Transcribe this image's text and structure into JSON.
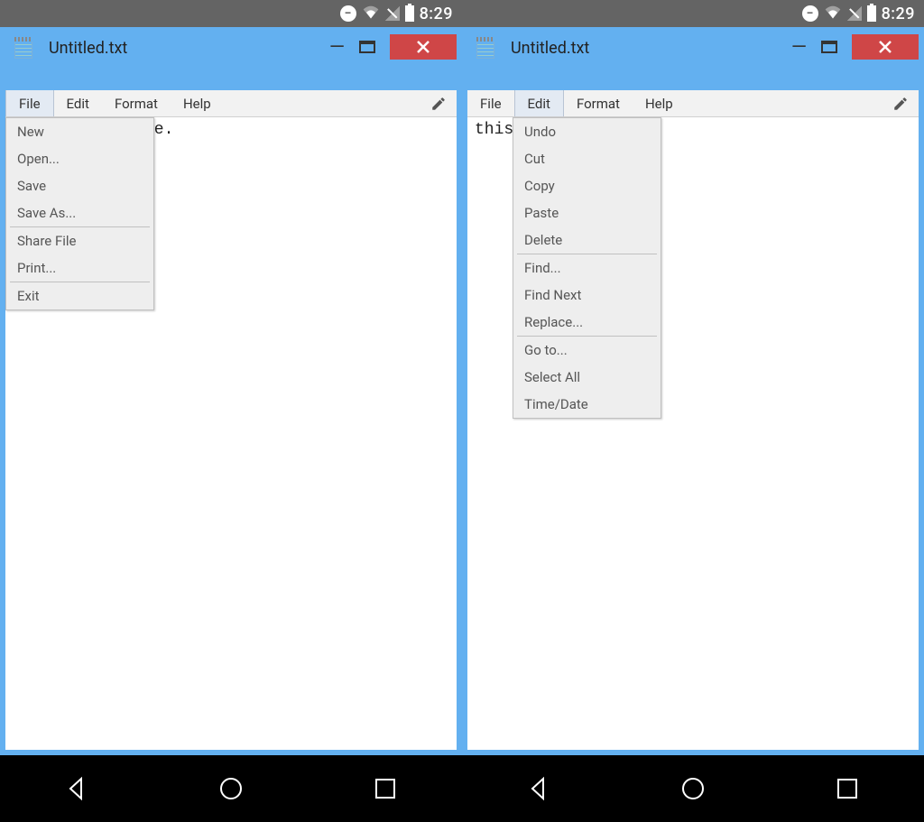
{
  "status_bar": {
    "time": "8:29"
  },
  "window": {
    "title": "Untitled.txt"
  },
  "menubar": {
    "file": "File",
    "edit": "Edit",
    "format": "Format",
    "help": "Help"
  },
  "file_menu": {
    "new": "New",
    "open": "Open...",
    "save": "Save",
    "save_as": "Save As...",
    "share_file": "Share File",
    "print": "Print...",
    "exit": "Exit"
  },
  "edit_menu": {
    "undo": "Undo",
    "cut": "Cut",
    "copy": "Copy",
    "paste": "Paste",
    "delete": "Delete",
    "find": "Find...",
    "find_next": "Find Next",
    "replace": "Replace...",
    "go_to": "Go to...",
    "select_all": "Select All",
    "time_date": "Time/Date"
  },
  "editor": {
    "left_text_visible": "te.",
    "right_text_visible": "this"
  }
}
